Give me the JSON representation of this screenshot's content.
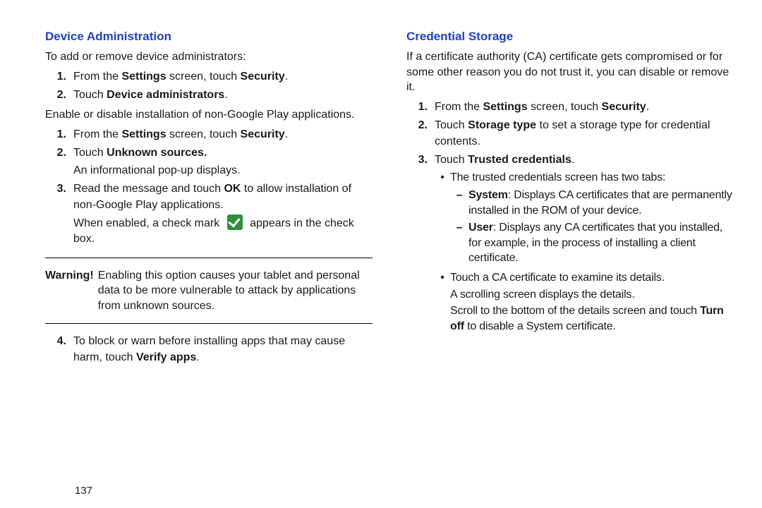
{
  "page_number": "137",
  "left": {
    "heading": "Device Administration",
    "intro": "To add or remove device administrators:",
    "list1": {
      "n1": "1.",
      "i1a": "From the ",
      "i1b": "Settings",
      "i1c": " screen, touch ",
      "i1d": "Security",
      "i1e": ".",
      "n2": "2.",
      "i2a": "Touch ",
      "i2b": "Device administrators",
      "i2c": "."
    },
    "para2": "Enable or disable installation of non-Google Play applications.",
    "list2": {
      "n1": "1.",
      "i1a": "From the ",
      "i1b": "Settings",
      "i1c": " screen, touch ",
      "i1d": "Security",
      "i1e": ".",
      "n2": "2.",
      "i2a": "Touch ",
      "i2b": "Unknown sources.",
      "i2_line2": "An informational pop-up displays.",
      "n3": "3.",
      "i3a": "Read the message and touch ",
      "i3b": "OK",
      "i3c": " to allow installation of non-Google Play applications.",
      "i3_line2a": "When enabled, a check mark ",
      "i3_line2b": " appears in the check box.",
      "n4": "4.",
      "i4a": "To block or warn before installing apps that may cause harm, touch ",
      "i4b": "Verify apps",
      "i4c": "."
    },
    "warning_label": "Warning!",
    "warning_text": " Enabling this option causes your tablet and personal data to be more vulnerable to attack by applications from unknown sources."
  },
  "right": {
    "heading": "Credential Storage",
    "intro": "If a certificate authority (CA) certificate gets compromised or for some other reason you do not trust it, you can disable or remove it.",
    "list1": {
      "n1": "1.",
      "i1a": "From the ",
      "i1b": "Settings",
      "i1c": " screen, touch ",
      "i1d": "Security",
      "i1e": ".",
      "n2": "2.",
      "i2a": "Touch ",
      "i2b": "Storage type",
      "i2c": " to set a storage type for credential contents.",
      "n3": "3.",
      "i3a": "Touch ",
      "i3b": "Trusted credentials",
      "i3c": "."
    },
    "bul1": "The trusted credentials screen has two tabs:",
    "dash1_lbl": "System",
    "dash1_txt": ": Displays CA certificates that are permanently installed in the ROM of your device.",
    "dash2_lbl": "User",
    "dash2_txt": ": Displays any CA certificates that you installed, for example, in the process of installing a client certificate.",
    "bul2": "Touch a CA certificate to examine its details.",
    "bul2_line2": "A scrolling screen displays the details.",
    "bul2_line3a": "Scroll to the bottom of the details screen and touch ",
    "bul2_line3b": "Turn off",
    "bul2_line3c": " to disable a System certificate."
  }
}
